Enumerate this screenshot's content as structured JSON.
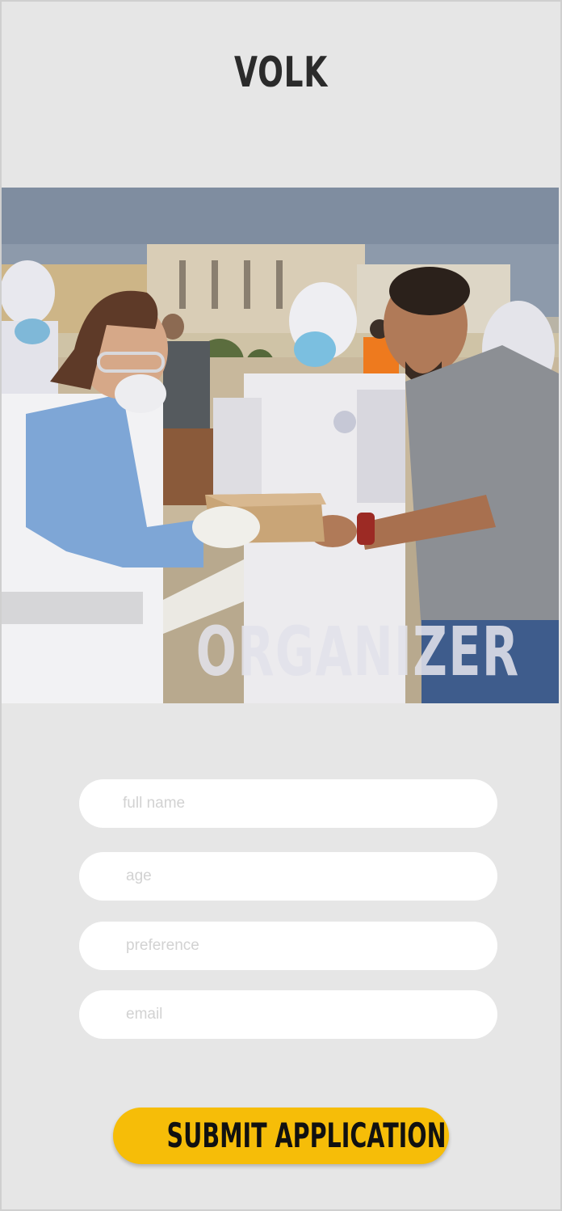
{
  "app": {
    "title": "VOLK"
  },
  "hero": {
    "caption": "ORGANIZER"
  },
  "form": {
    "full_name": {
      "value": "",
      "placeholder": "full name"
    },
    "age": {
      "value": "",
      "placeholder": "age"
    },
    "preference": {
      "value": "",
      "placeholder": "preference"
    },
    "email": {
      "value": "",
      "placeholder": "email"
    },
    "submit_label": "SUBMIT APPLICATION"
  },
  "colors": {
    "background": "#e6e6e6",
    "field": "#ffffff",
    "accent": "#f6bd08",
    "title_text": "#2b2b2b"
  }
}
